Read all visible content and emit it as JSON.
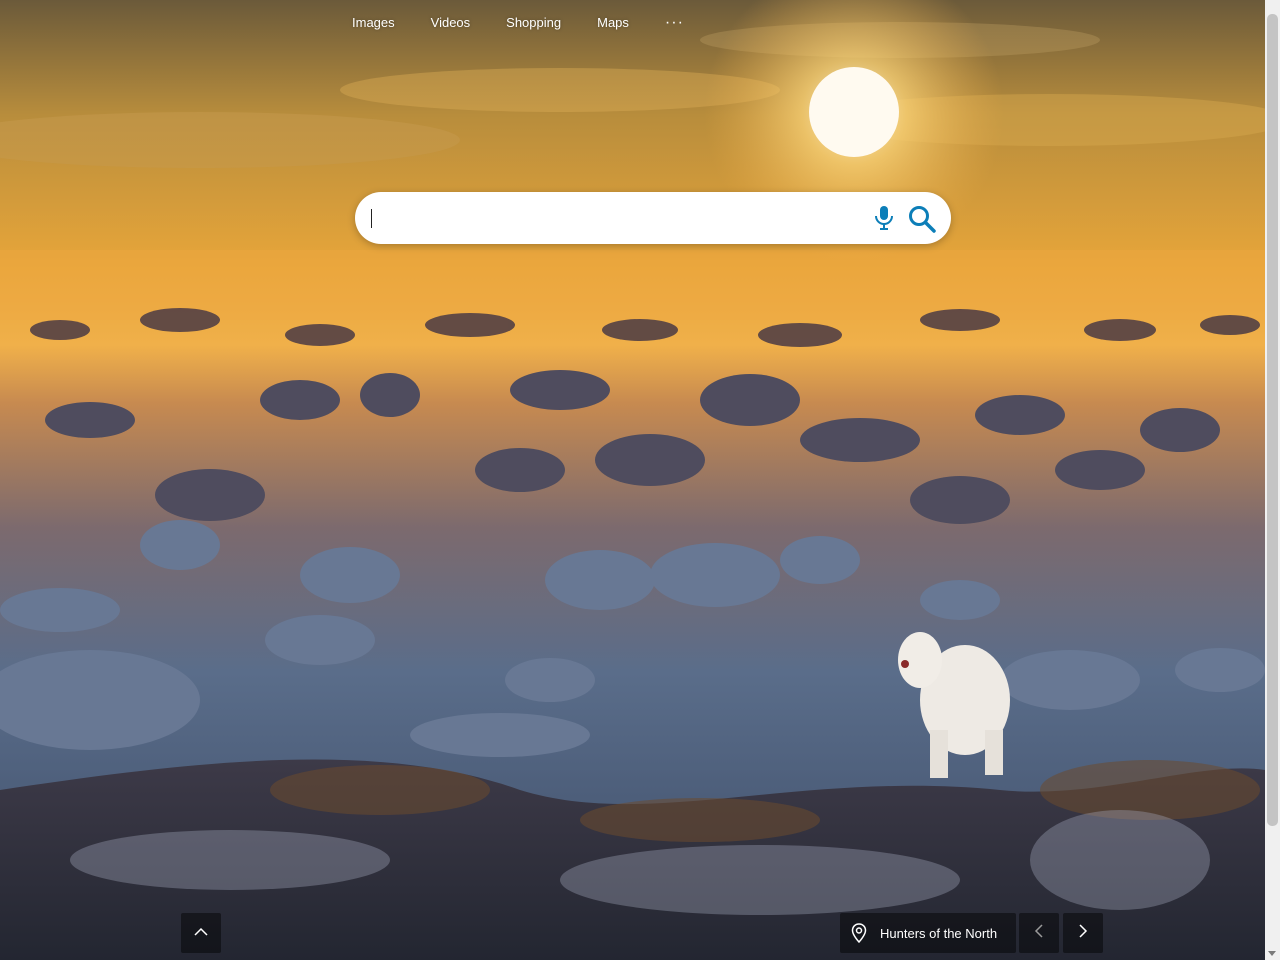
{
  "nav": {
    "items": [
      {
        "label": "Images"
      },
      {
        "label": "Videos"
      },
      {
        "label": "Shopping"
      },
      {
        "label": "Maps"
      }
    ],
    "more_label": "···"
  },
  "search": {
    "value": "",
    "placeholder": ""
  },
  "image_info": {
    "title": "Hunters of the North"
  },
  "icons": {
    "mic": "microphone-icon",
    "search": "search-icon",
    "collapse": "chevron-up-icon",
    "location": "location-pin-icon",
    "prev": "chevron-left-icon",
    "next": "chevron-right-icon"
  },
  "colors": {
    "accent": "#0c7eb8",
    "search_bg": "#ffffff",
    "overlay": "#000000"
  }
}
